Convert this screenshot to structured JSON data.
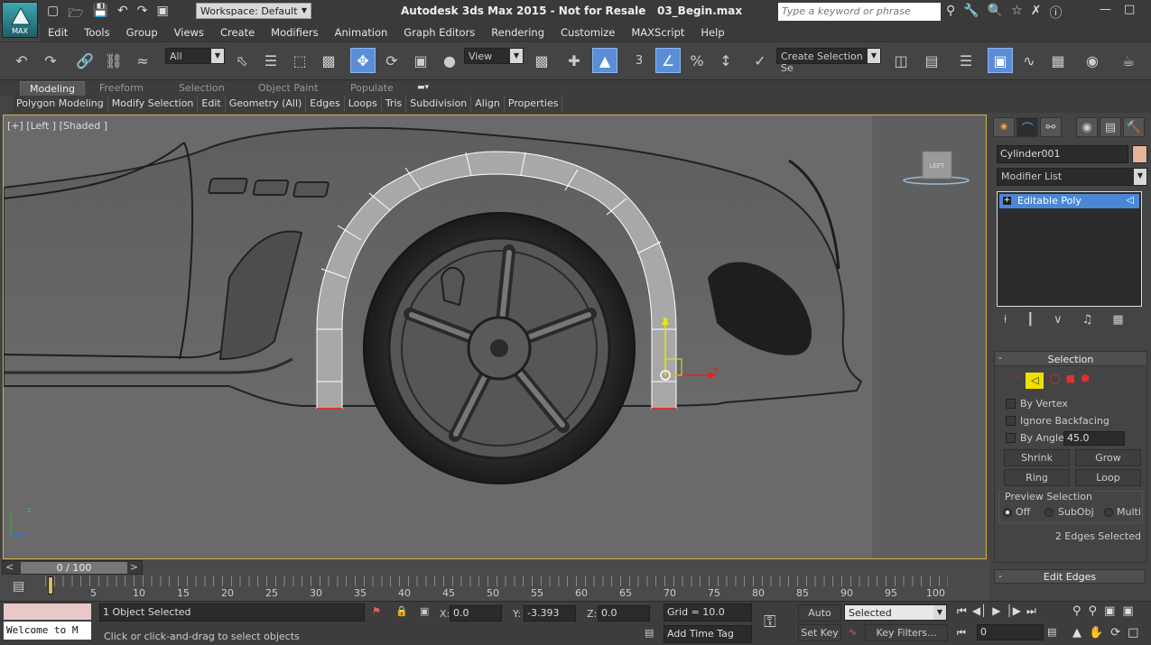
{
  "title": {
    "app": "Autodesk 3ds Max  2015   - Not for Resale",
    "file": "03_Begin.max",
    "workspace": "Workspace: Default",
    "search_placeholder": "Type a keyword or phrase",
    "logo": "MAX"
  },
  "menu": [
    "Edit",
    "Tools",
    "Group",
    "Views",
    "Create",
    "Modifiers",
    "Animation",
    "Graph Editors",
    "Rendering",
    "Customize",
    "MAXScript",
    "Help"
  ],
  "toolbar": {
    "filter_value": "All",
    "refcoord_value": "View",
    "selection_set_value": "Create Selection Se",
    "snap_label": "3"
  },
  "ribbon": {
    "tabs": [
      "Modeling",
      "Freeform",
      "Selection",
      "Object Paint",
      "Populate"
    ],
    "active_tab": "Modeling",
    "panel_items": [
      "Polygon Modeling",
      "Modify Selection",
      "Edit",
      "Geometry (All)",
      "Edges",
      "Loops",
      "Tris",
      "Subdivision",
      "Align",
      "Properties"
    ]
  },
  "viewport": {
    "label": "[+] [Left ] [Shaded ]",
    "viewcube_label": "LEFT",
    "axis_x": "x",
    "axis_y": "y",
    "axis_z": "z"
  },
  "command_panel": {
    "object_name": "Cylinder001",
    "object_color": "#e5b49a",
    "modifier_list": "Modifier List",
    "stack_item": "Editable Poly",
    "selection_rollout": {
      "title": "Selection",
      "by_vertex": "By Vertex",
      "ignore_backfacing": "Ignore Backfacing",
      "by_angle": "By Angle:",
      "angle_value": "45.0",
      "shrink": "Shrink",
      "grow": "Grow",
      "ring": "Ring",
      "loop": "Loop",
      "preview_selection": "Preview Selection",
      "preview_off": "Off",
      "preview_subobj": "SubObj",
      "preview_multi": "Multi",
      "selection_status": "2 Edges Selected"
    },
    "edit_edges": "Edit Edges"
  },
  "timeline": {
    "frame_display": "0 / 100",
    "ticks": [
      "5",
      "10",
      "15",
      "20",
      "25",
      "30",
      "35",
      "40",
      "45",
      "50",
      "55",
      "60",
      "65",
      "70",
      "75",
      "80",
      "85",
      "90",
      "95",
      "100"
    ]
  },
  "status": {
    "maxscript": "Welcome to M",
    "selected": "1 Object Selected",
    "prompt": "Click or click-and-drag to select objects",
    "x_label": "X:",
    "x_value": "0.0",
    "y_label": "Y:",
    "y_value": "-3.393",
    "z_label": "Z:",
    "z_value": "0.0",
    "grid": "Grid = 10.0",
    "add_time_tag": "Add Time Tag",
    "auto_key": "Auto Key",
    "set_key": "Set Key",
    "key_mode": "Selected",
    "key_filters": "Key Filters...",
    "current_frame": "0"
  }
}
